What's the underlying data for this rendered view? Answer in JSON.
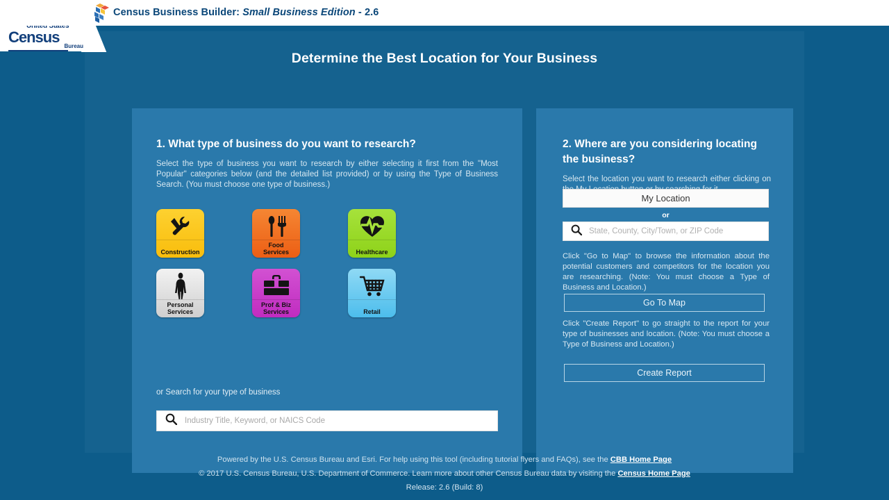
{
  "topbar": {
    "logo_icon": "cbb-cubes-icon",
    "title_prefix": "Census Business Builder: ",
    "title_italic": "Small Business Edition",
    "title_suffix": " - 2.6"
  },
  "census_logo": {
    "line1": "United States",
    "line2": "Census",
    "line3": "Bureau"
  },
  "page": {
    "title": "Determine the Best Location for Your Business"
  },
  "left_panel": {
    "heading": "1. What type of business do you want to research?",
    "description": "Select the type of business you want to research by either selecting it first from the \"Most Popular\" categories below (and the detailed list provided) or by using the Type of Business Search. (You must choose one type of business.)",
    "search_label": "or Search for your type of business",
    "search": {
      "icon": "search-icon",
      "placeholder": "Industry Title, Keyword, or NAICS Code",
      "value": ""
    },
    "categories": [
      {
        "id": "construction",
        "label": "Construction",
        "icon": "hammer-wrench-icon",
        "color": "#f9bd0c"
      },
      {
        "id": "food",
        "label": "Food\nServices",
        "icon": "spoon-fork-icon",
        "color": "#ec5e14"
      },
      {
        "id": "healthcare",
        "label": "Healthcare",
        "icon": "heart-pulse-icon",
        "color": "#8ed219"
      },
      {
        "id": "personal",
        "label": "Personal\nServices",
        "icon": "person-icon",
        "color": "#cfcfcf"
      },
      {
        "id": "prof",
        "label": "Prof & Biz\nServices",
        "icon": "briefcase-icon",
        "color": "#c02cc0"
      },
      {
        "id": "retail",
        "label": "Retail",
        "icon": "shopping-cart-icon",
        "color": "#4cbdec"
      }
    ],
    "category_labels": {
      "construction": "Construction",
      "food_line1": "Food",
      "food_line2": "Services",
      "healthcare": "Healthcare",
      "personal_line1": "Personal",
      "personal_line2": "Services",
      "prof_line1": "Prof & Biz",
      "prof_line2": "Services",
      "retail": "Retail"
    }
  },
  "right_panel": {
    "heading": "2. Where are you considering locating the business?",
    "description": "Select the location you want to research either clicking on the My Location button or by searching for it.",
    "my_location_label": "My Location",
    "or_label": "or",
    "location_search": {
      "icon": "search-icon",
      "placeholder": "State, County, City/Town, or ZIP Code",
      "value": ""
    },
    "map_hint": "Click \"Go to Map\" to browse the information about the potential customers and competitors for the location you are researching. (Note: You must choose a Type of Business and Location.)",
    "go_to_map_label": "Go To Map",
    "report_hint": "Click \"Create Report\" to go straight to the report for your type of businesses and location. (Note: You must choose a Type of Business and Location.)",
    "create_report_label": "Create Report"
  },
  "footer": {
    "line1_pre": "Powered by the U.S. Census Bureau and Esri. For help using this tool (including tutorial flyers and FAQs), see the ",
    "line1_link": "CBB Home Page",
    "line2_pre": "© 2017 U.S. Census Bureau, U.S. Department of Commerce. Learn more about other Census Bureau data by visiting the ",
    "line2_link": "Census Home Page",
    "release": "Release: 2.6 (Build: 8)"
  },
  "colors": {
    "outer_bg": "#0d5c8a",
    "content_bg": "#15628f",
    "panel_bg": "#2a79ab",
    "header_bg": "#ffffff",
    "brand_navy": "#123F7B"
  }
}
